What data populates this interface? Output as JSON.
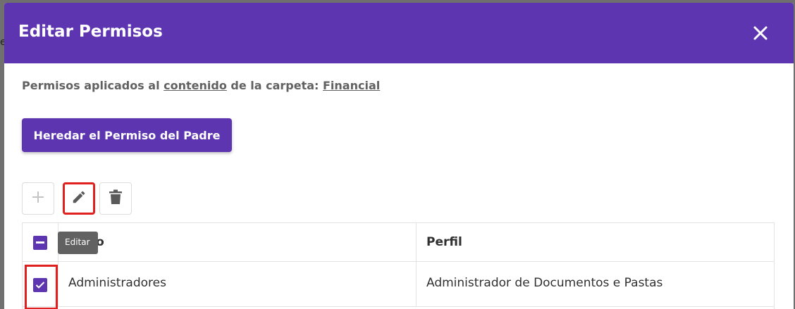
{
  "dialog": {
    "title": "Editar Permisos",
    "close_icon": "close-icon"
  },
  "backdrop": {
    "edge_glyph": "e"
  },
  "subtitle": {
    "prefix": "Permisos aplicados al ",
    "link1": "contenido",
    "middle": " de la carpeta: ",
    "link2": "Financial"
  },
  "inherit_button": {
    "label": "Heredar el Permiso del Padre"
  },
  "toolbar": {
    "add_icon": "plus-icon",
    "edit_icon": "pencil-icon",
    "delete_icon": "trash-icon",
    "tooltip": "Editar"
  },
  "table": {
    "columns": [
      "Grupo",
      "Perfil"
    ],
    "header_visible_group_text": "po",
    "rows": [
      {
        "grupo": "Administradores",
        "perfil": "Administrador de Documentos e Pastas",
        "checked": true
      }
    ]
  },
  "colors": {
    "accent": "#5e35b1",
    "highlight": "#e0201f",
    "tooltip_bg": "#616161"
  }
}
